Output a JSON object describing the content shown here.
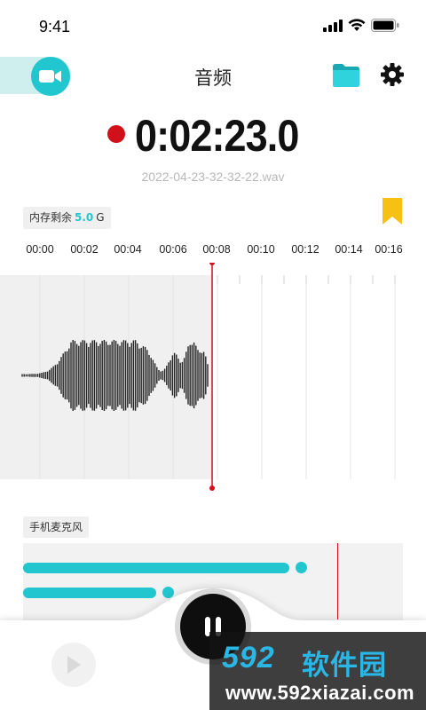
{
  "status": {
    "time": "9:41"
  },
  "header": {
    "title": "音频",
    "icons": [
      "video-camera-icon",
      "folder-icon",
      "gear-icon"
    ]
  },
  "recorder": {
    "time": "0:02:23.0",
    "filename": "2022-04-23-32-32-22.wav",
    "recording": true
  },
  "memory": {
    "label": "内存剩余",
    "value": "5.0",
    "unit": "G"
  },
  "timeline": {
    "ticks": [
      "00:00",
      "00:02",
      "00:04",
      "00:06",
      "00:08",
      "00:10",
      "00:12",
      "00:14",
      "00:16"
    ],
    "playhead": "00:08"
  },
  "source": {
    "label": "手机麦克风"
  },
  "levels": [
    0.7,
    0.35
  ],
  "watermark": {
    "brand": "592",
    "name": "软件园",
    "url": "www.592xiazai.com"
  },
  "colors": {
    "accent": "#22c6cf",
    "record": "#d2101a",
    "bookmark": "#f6c015"
  }
}
